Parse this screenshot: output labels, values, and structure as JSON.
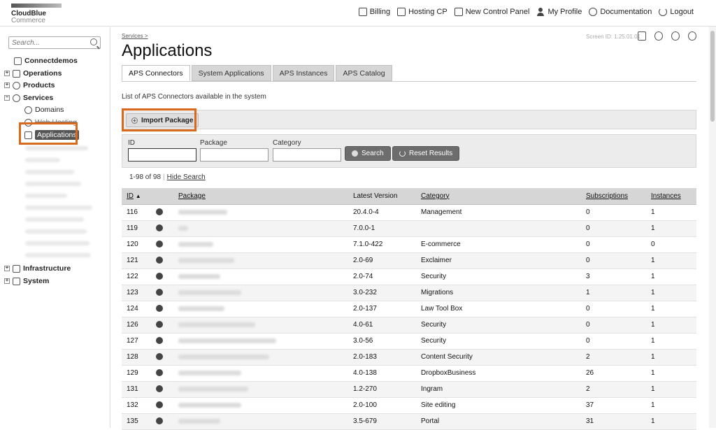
{
  "brand": {
    "line1": "CloudBlue",
    "line2": "Commerce"
  },
  "topnav": [
    {
      "label": "Billing",
      "icon": "billing-icon"
    },
    {
      "label": "Hosting CP",
      "icon": "hosting-cp-icon"
    },
    {
      "label": "New Control Panel",
      "icon": "control-panel-icon"
    },
    {
      "label": "My Profile",
      "icon": "profile-icon"
    },
    {
      "label": "Documentation",
      "icon": "documentation-icon"
    },
    {
      "label": "Logout",
      "icon": "power-icon"
    }
  ],
  "sidebar": {
    "search_placeholder": "Search...",
    "items": [
      {
        "label": "Connectdemos"
      },
      {
        "label": "Operations"
      },
      {
        "label": "Products"
      },
      {
        "label": "Services"
      },
      {
        "label": "Domains"
      },
      {
        "label": "Web Hosting"
      },
      {
        "label": "Applications"
      },
      {
        "label": "Infrastructure"
      },
      {
        "label": "System"
      }
    ]
  },
  "main": {
    "breadcrumb": "Services",
    "breadcrumb_sep": ">",
    "title": "Applications",
    "screen_id": "Screen ID: 1.25.01.01",
    "tabs": [
      {
        "label": "APS Connectors"
      },
      {
        "label": "System Applications"
      },
      {
        "label": "APS Instances"
      },
      {
        "label": "APS Catalog"
      }
    ],
    "description": "List of APS Connectors available in the system",
    "import_label": "Import Package",
    "filter": {
      "id_label": "ID",
      "package_label": "Package",
      "category_label": "Category",
      "search_label": "Search",
      "reset_label": "Reset Results"
    },
    "count_text": "1-98 of 98",
    "hide_search": "Hide Search",
    "columns": [
      "ID",
      "Package",
      "Latest Version",
      "Category",
      "Subscriptions",
      "Instances"
    ],
    "rows": [
      {
        "id": "116",
        "version": "20.4.0-4",
        "category": "Management",
        "subs": "0",
        "inst": "1"
      },
      {
        "id": "119",
        "version": "7.0.0-1",
        "category": "",
        "subs": "0",
        "inst": "1"
      },
      {
        "id": "120",
        "version": "7.1.0-422",
        "category": "E-commerce",
        "subs": "0",
        "inst": "0"
      },
      {
        "id": "121",
        "version": "2.0-69",
        "category": "Exclaimer",
        "subs": "0",
        "inst": "1"
      },
      {
        "id": "122",
        "version": "2.0-74",
        "category": "Security",
        "subs": "3",
        "inst": "1"
      },
      {
        "id": "123",
        "version": "3.0-232",
        "category": "Migrations",
        "subs": "1",
        "inst": "1"
      },
      {
        "id": "124",
        "version": "2.0-137",
        "category": "Law Tool Box",
        "subs": "0",
        "inst": "1"
      },
      {
        "id": "126",
        "version": "4.0-61",
        "category": "Security",
        "subs": "0",
        "inst": "1"
      },
      {
        "id": "127",
        "version": "3.0-56",
        "category": "Security",
        "subs": "0",
        "inst": "1"
      },
      {
        "id": "128",
        "version": "2.0-183",
        "category": "Content Security",
        "subs": "2",
        "inst": "1"
      },
      {
        "id": "129",
        "version": "4.0-138",
        "category": "DropboxBusiness",
        "subs": "26",
        "inst": "1"
      },
      {
        "id": "131",
        "version": "1.2-270",
        "category": "Ingram",
        "subs": "2",
        "inst": "1"
      },
      {
        "id": "132",
        "version": "2.0-100",
        "category": "Site editing",
        "subs": "37",
        "inst": "1"
      },
      {
        "id": "135",
        "version": "3.5-679",
        "category": "Portal",
        "subs": "31",
        "inst": "1"
      }
    ]
  },
  "colors": {
    "highlight": "#d96a1d",
    "header_bg": "#d6d6d6"
  }
}
